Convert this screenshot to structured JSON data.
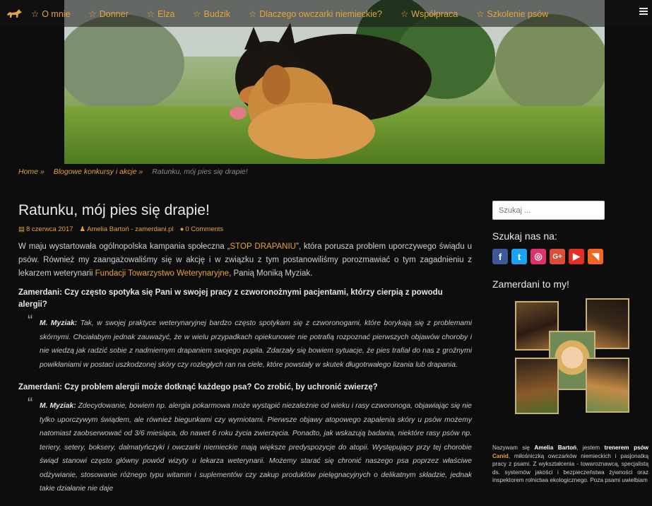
{
  "nav": {
    "items": [
      "O mnie",
      "Donner",
      "Elza",
      "Budzik",
      "Dlaczego owczarki niemieckie?",
      "Współpraca",
      "Szkolenie psów"
    ]
  },
  "breadcrumb": {
    "home": "Home »",
    "category": "Blogowe konkursy i akcje »",
    "current": "Ratunku, mój pies się drapie!"
  },
  "post": {
    "title": "Ratunku, mój pies się drapie!",
    "date": "8 czerwca 2017",
    "author": "Amelia Bartoń - zamerdani.pl",
    "comments": "0 Comments",
    "intro_a": "W maju wystartowała ogólnopolska kampania społeczna „",
    "intro_link1": "STOP DRAPANIU",
    "intro_b": "”, która porusza problem uporczywego świądu u psów. Również my zaangażowaliśmy się w akcję i w związku z tym postanowiliśmy porozmawiać o tym zagadnieniu z lekarzem weterynarii ",
    "intro_link2": "Fundacji Towarzystwo Weterynaryjne",
    "intro_c": ", Panią Moniką Myziak.",
    "q1": "Zamerdani: Czy często spotyka się Pani w swojej pracy z czworonożnymi pacjentami, którzy cierpią z powodu alergii?",
    "a1_speaker": "M. Myziak:",
    "a1_text": " Tak, w swojej praktyce weterynaryjnej bardzo często spotykam się z czworonogami, które borykają się z problemami skórnymi. Chciałabym jednak zauważyć, że w wielu przypadkach opiekunowie nie potrafią rozpoznać pierwszych objawów choroby i nie wiedzą jak radzić sobie z nadmiernym drapaniem swojego pupila. Zdarzały się bowiem sytuacje, że pies trafiał do nas z groźnymi powikłaniami w postaci uszkodzonej skóry czy rozległych ran na ciele, które powstały w skutek długotrwałego lizania lub drapania.",
    "q2": "Zamerdani: Czy problem alergii może dotknąć każdego psa? Co zrobić, by uchronić zwierzę?",
    "a2_speaker": "M. Myziak:",
    "a2_text": " Zdecydowanie, bowiem np. alergia pokarmowa może wystąpić niezależnie od wieku i rasy czworonoga, objawiając się nie tylko uporczywym świądem, ale również biegunkami czy wymiotami. Pierwsze objawy atopowego zapalenia skóry u psów możemy natomiast zaobserwować od 3/6 miesiąca, do nawet 6 roku życia zwierzęcia. Ponadto, jak wskazują badania, niektóre rasy psów np. teriery, setery, boksery, dalmatyńczyki i owczarki niemieckie mają większe predyspozycje do atopii. Występujący przy tej chorobie świąd stanowi często główny powód wizyty u lekarza weterynarii. Możemy starać się chronić naszego psa poprzez właściwe odżywianie, stosowanie różnego typu witamin i suplementów czy zakup produktów pielęgnacyjnych o delikatnym składzie, jednak takie działanie nie daje"
  },
  "sidebar": {
    "search_placeholder": "Szukaj ...",
    "find_us": "Szukaj nas na:",
    "socials": [
      {
        "name": "facebook-icon",
        "glyph": "f",
        "color": "#3b5998"
      },
      {
        "name": "twitter-icon",
        "glyph": "t",
        "color": "#1da1f2"
      },
      {
        "name": "instagram-icon",
        "glyph": "◎",
        "color": "#e1306c"
      },
      {
        "name": "google-plus-icon",
        "glyph": "G+",
        "color": "#dd4b39"
      },
      {
        "name": "youtube-icon",
        "glyph": "▶",
        "color": "#e52d27"
      },
      {
        "name": "rss-icon",
        "glyph": "◥",
        "color": "#f26522"
      }
    ],
    "we_are": "Zamerdani to my!",
    "bio_1": "Nazywam się ",
    "bio_name": "Amelia Bartoń",
    "bio_2": ", jestem ",
    "bio_trainer": "trenerem psów",
    "bio_3": " ",
    "bio_canid": "Canid",
    "bio_4": ", miłośniczką owczarków niemieckich i pasjonatką pracy z psami. Z wykształcenia - towaroznawcą, specjalistą ds. systemów jakości i bezpieczeństwa żywności oraz inspektorem rolnictwa ekologicznego. Poza psami uwielbiam"
  },
  "colors": {
    "accent": "#e6a23c",
    "background": "#0d0d0d"
  }
}
